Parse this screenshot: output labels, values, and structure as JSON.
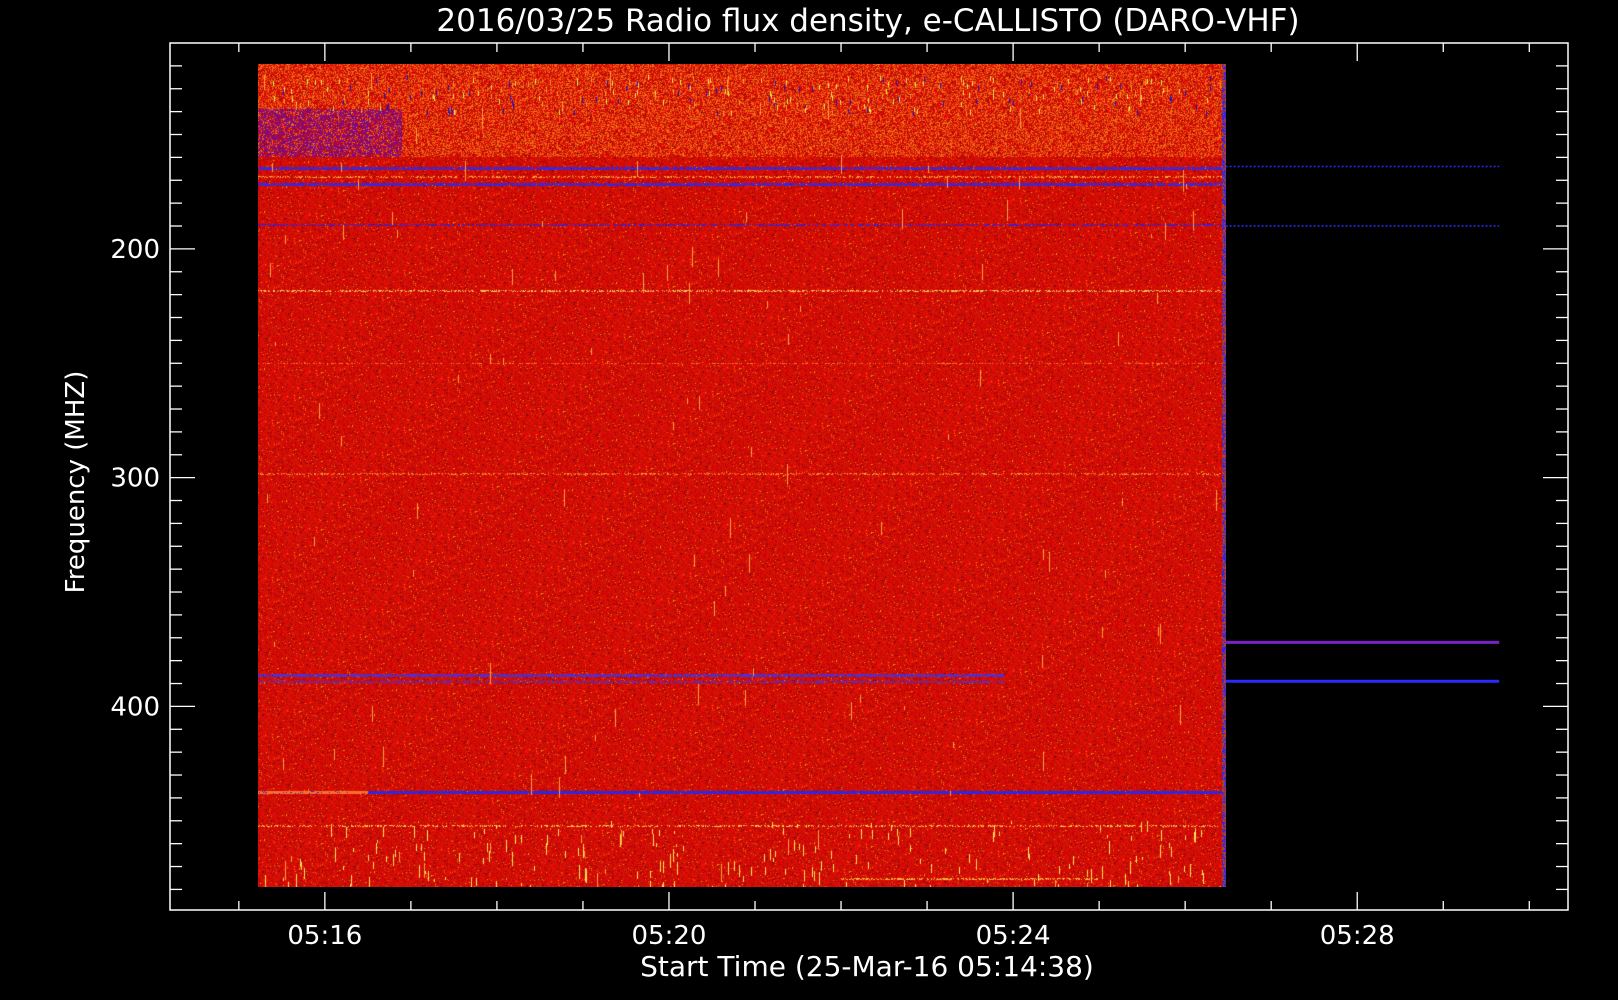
{
  "chart_data": {
    "type": "heatmap",
    "title": "2016/03/25  Radio flux density, e-CALLISTO (DARO-VHF)",
    "xlabel": "Start Time (25-Mar-16 05:14:38)",
    "ylabel": "Frequency (MHZ)",
    "x_tick_labels": [
      "05:16",
      "05:20",
      "05:24",
      "05:28"
    ],
    "y_tick_labels": [
      "200",
      "300",
      "400"
    ],
    "x_ticks_minutes": [
      16,
      20,
      24,
      28
    ],
    "y_ticks_mhz": [
      200,
      300,
      400
    ],
    "xlim_minutes": [
      14.2,
      30.45
    ],
    "ylim_mhz": [
      110,
      489
    ],
    "data_extent": {
      "time_minutes": [
        15.22,
        26.47
      ],
      "freq_mhz": [
        119,
        479
      ]
    },
    "after_data_end_lines_mhz": [
      164,
      190,
      372,
      389
    ],
    "grid": false,
    "colormap": [
      "#000000",
      "#1a1aff",
      "#8a00b0",
      "#c00000",
      "#e81a00",
      "#ff5a0a",
      "#ffb030",
      "#ffff80"
    ],
    "background_color": "#000000",
    "dominant_color": "#c81400"
  }
}
